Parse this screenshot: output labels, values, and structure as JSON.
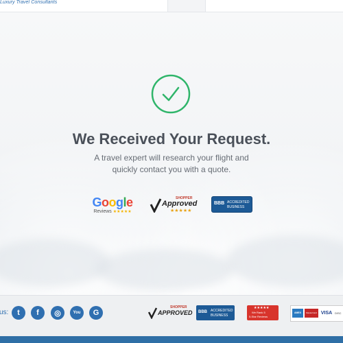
{
  "header": {
    "tagline": "Luxury Travel Consultants"
  },
  "confirmation": {
    "title": "We Received Your Request.",
    "message": "A travel expert will research your flight and quickly contact you with a quote."
  },
  "badges": {
    "google": {
      "brand": "Google",
      "sub": "Reviews"
    },
    "shopper_approved": {
      "top": "SHOPPER",
      "main": "Approved"
    },
    "bbb": {
      "logo": "BBB",
      "line1": "ACCREDITED",
      "line2": "BUSINESS"
    }
  },
  "footer": {
    "follow_label": "us:",
    "social": [
      {
        "name": "twitter",
        "glyph": "t"
      },
      {
        "name": "facebook",
        "glyph": "f"
      },
      {
        "name": "instagram",
        "glyph": "◎"
      },
      {
        "name": "youtube",
        "glyph": "You"
      },
      {
        "name": "google",
        "glyph": "G"
      }
    ],
    "shopper": {
      "top": "SHOPPER",
      "main": "APPROVED"
    },
    "bbb": {
      "logo": "BBB",
      "line1": "ACCREDITED",
      "line2": "BUSINESS"
    },
    "sitejabber": {
      "line1": "We Rank 5",
      "line2": "5-Star Reviews"
    },
    "payments": [
      "AMEX",
      "MasterCard",
      "VISA",
      "DISC"
    ]
  },
  "colors": {
    "success_green": "#2fb56a",
    "brand_blue": "#2f6fb0",
    "bbb_blue": "#1d5a96"
  }
}
